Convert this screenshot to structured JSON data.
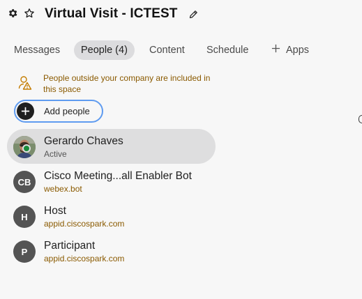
{
  "header": {
    "settings_icon": "gear-icon",
    "favorite_icon": "star-icon",
    "title": "Virtual Visit - ICTEST",
    "edit_icon": "pencil-icon"
  },
  "tabs": [
    {
      "label": "Messages",
      "active": false
    },
    {
      "label": "People (4)",
      "active": true
    },
    {
      "label": "Content",
      "active": false
    },
    {
      "label": "Schedule",
      "active": false
    },
    {
      "label": "Apps",
      "active": false,
      "icon": "plus-icon"
    }
  ],
  "notice": {
    "icon": "external-people-icon",
    "text": "People outside your company are included in this space",
    "color": "#8a5a00"
  },
  "add_people": {
    "label": "Add people",
    "icon": "plus-icon",
    "focus_color": "#5e9bf0"
  },
  "people": [
    {
      "name": "Gerardo Chaves",
      "subtitle": "Active",
      "avatar": "photo",
      "status": "active",
      "selected": true
    },
    {
      "name": "Cisco Meeting...all Enabler Bot",
      "subtitle": "webex.bot",
      "avatar": "CB",
      "external": true
    },
    {
      "name": "Host",
      "subtitle": "appid.ciscospark.com",
      "avatar": "H",
      "external": true
    },
    {
      "name": "Participant",
      "subtitle": "appid.ciscospark.com",
      "avatar": "P",
      "external": true
    }
  ]
}
